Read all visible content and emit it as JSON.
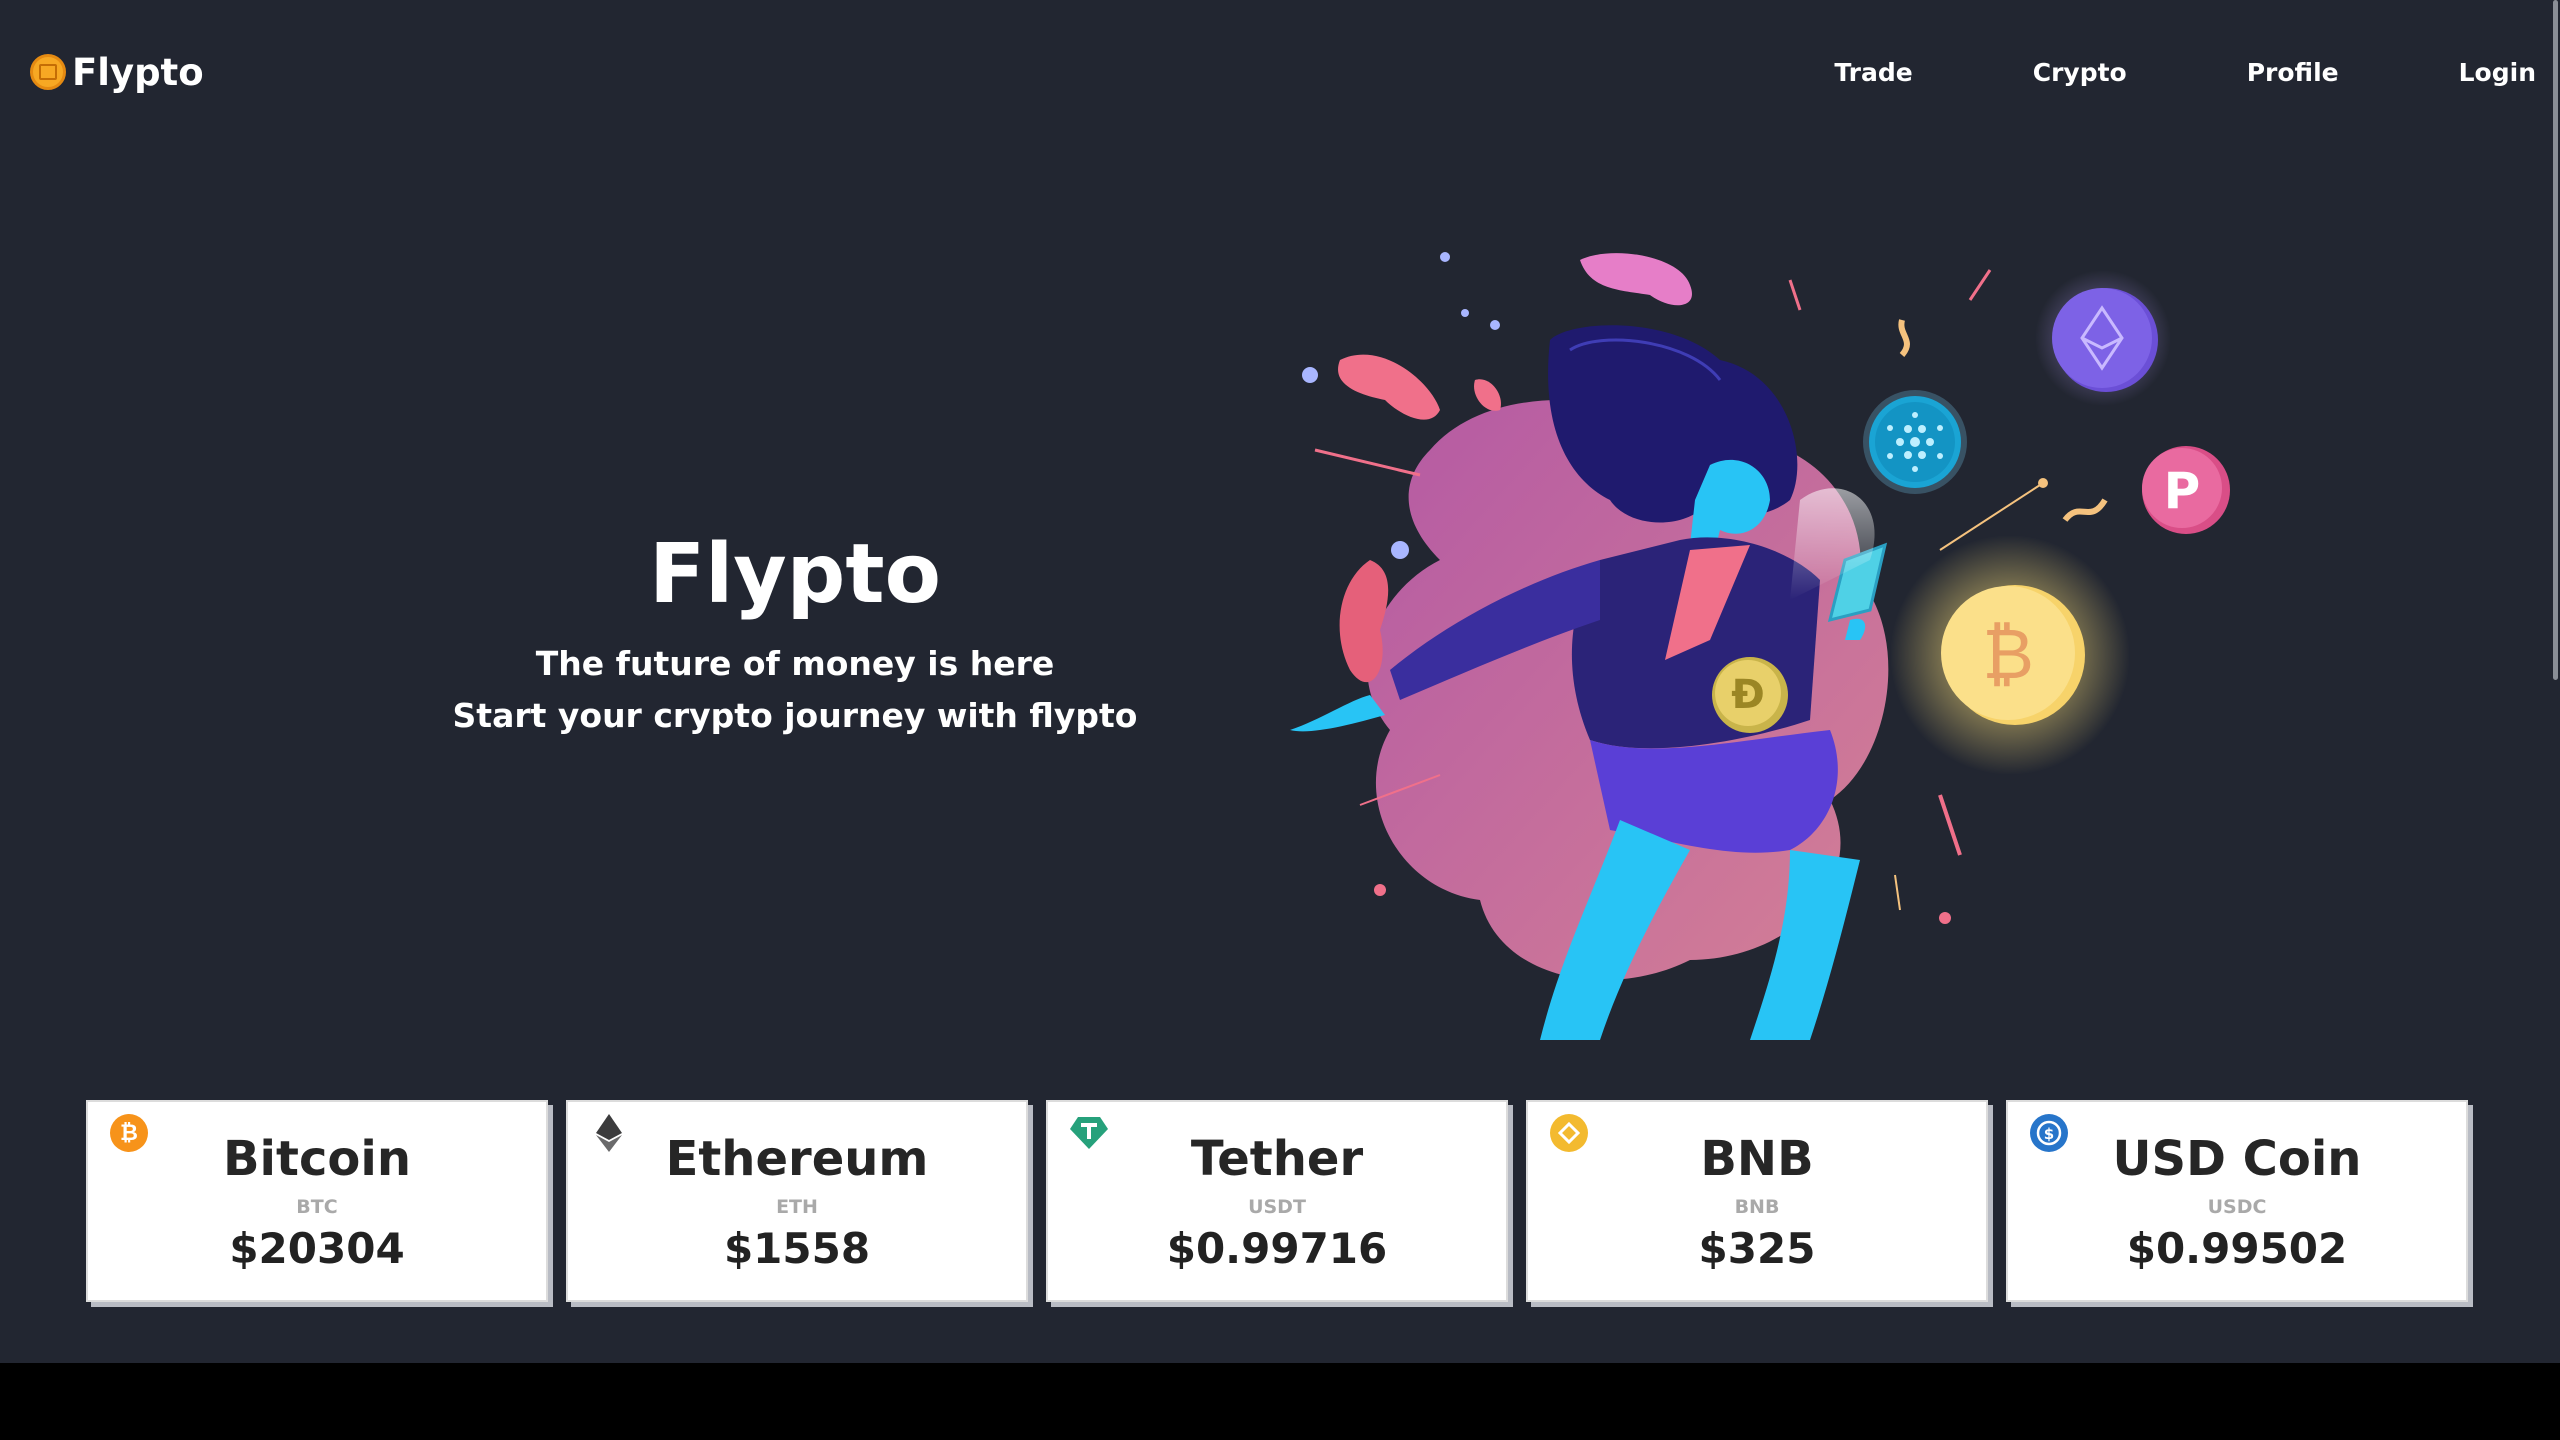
{
  "brand": {
    "name": "Flypto",
    "icon": "coin-icon",
    "color": "#f7a823"
  },
  "nav": {
    "items": [
      {
        "label": "Trade"
      },
      {
        "label": "Crypto"
      },
      {
        "label": "Profile"
      },
      {
        "label": "Login"
      }
    ]
  },
  "hero": {
    "title": "Flypto",
    "line1": "The future of money is here",
    "line2": "Start your crypto journey with flypto",
    "illustration": "woman-with-crypto-coins-illustration"
  },
  "cards": [
    {
      "name": "Bitcoin",
      "symbol": "BTC",
      "price": "$20304",
      "icon": "bitcoin-icon",
      "color": "#f7931a"
    },
    {
      "name": "Ethereum",
      "symbol": "ETH",
      "price": "$1558",
      "icon": "ethereum-icon",
      "color": "#3c3c3d"
    },
    {
      "name": "Tether",
      "symbol": "USDT",
      "price": "$0.99716",
      "icon": "tether-icon",
      "color": "#26a17b"
    },
    {
      "name": "BNB",
      "symbol": "BNB",
      "price": "$325",
      "icon": "bnb-icon",
      "color": "#f3ba2f"
    },
    {
      "name": "USD Coin",
      "symbol": "USDC",
      "price": "$0.99502",
      "icon": "usd-coin-icon",
      "color": "#2775ca"
    }
  ],
  "colors": {
    "background": "#222631",
    "text": "#ffffff",
    "card": "#ffffff"
  }
}
